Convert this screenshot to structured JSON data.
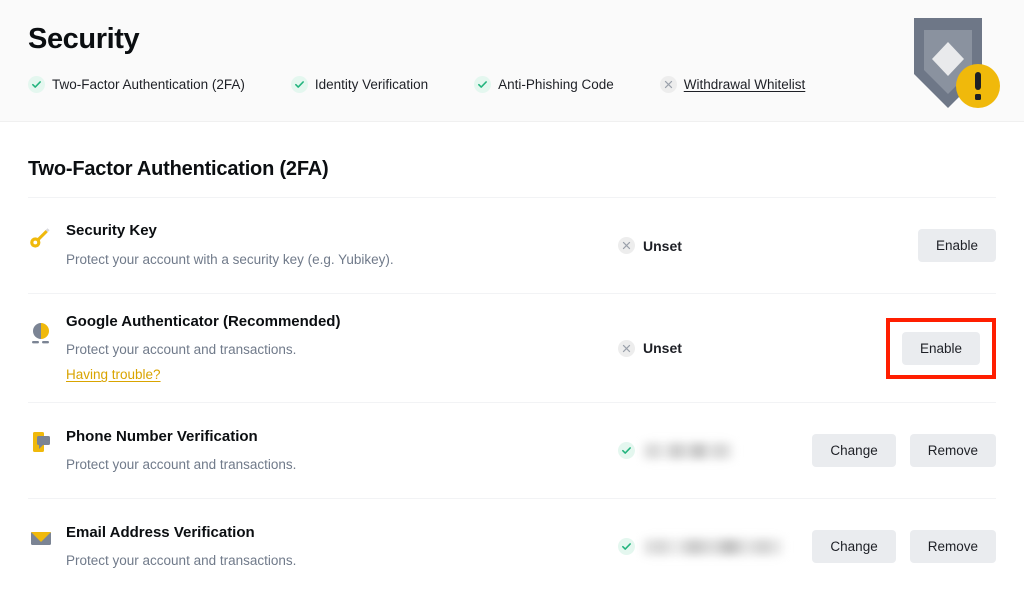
{
  "header": {
    "title": "Security",
    "shield_icon": "shield-warning-icon",
    "colors": {
      "shield_outer": "#6e7787",
      "shield_inner": "#8a929f",
      "shield_diamond": "#e9eaec",
      "warning_badge": "#f0b90b",
      "accent_link": "#d9a400",
      "check_green": "#23b47e",
      "highlight_red": "#ff1e00",
      "button_bg": "#eaecef",
      "header_bg": "#fafafa"
    },
    "status_items": [
      {
        "label": "Two-Factor Authentication (2FA)",
        "state": "ok",
        "icon": "check-circle-icon",
        "underlined": false
      },
      {
        "label": "Identity Verification",
        "state": "ok",
        "icon": "check-circle-icon",
        "underlined": false
      },
      {
        "label": "Anti-Phishing Code",
        "state": "ok",
        "icon": "check-circle-icon",
        "underlined": false
      },
      {
        "label": "Withdrawal Whitelist",
        "state": "none",
        "icon": "x-circle-icon",
        "underlined": true
      }
    ]
  },
  "main": {
    "section_title": "Two-Factor Authentication (2FA)",
    "rows": [
      {
        "name": "Security Key",
        "description": "Protect your account with a security key (e.g. Yubikey).",
        "icon": "security-key-icon",
        "link": null,
        "status_kind": "unset",
        "status_text": "Unset",
        "status_icon": "x-circle-icon",
        "actions": [
          {
            "label": "Enable",
            "name": "enable-button",
            "highlighted": false
          }
        ]
      },
      {
        "name": "Google Authenticator (Recommended)",
        "description": "Protect your account and transactions.",
        "icon": "google-authenticator-icon",
        "link": "Having trouble?",
        "status_kind": "unset",
        "status_text": "Unset",
        "status_icon": "x-circle-icon",
        "actions": [
          {
            "label": "Enable",
            "name": "enable-button",
            "highlighted": true
          }
        ]
      },
      {
        "name": "Phone Number Verification",
        "description": "Protect your account and transactions.",
        "icon": "phone-verification-icon",
        "link": null,
        "status_kind": "verified-redacted",
        "status_text": "",
        "status_icon": "check-circle-icon",
        "actions": [
          {
            "label": "Change",
            "name": "change-button",
            "highlighted": false
          },
          {
            "label": "Remove",
            "name": "remove-button",
            "highlighted": false
          }
        ]
      },
      {
        "name": "Email Address Verification",
        "description": "Protect your account and transactions.",
        "icon": "email-verification-icon",
        "link": null,
        "status_kind": "verified-redacted",
        "status_text": "",
        "status_icon": "check-circle-icon",
        "actions": [
          {
            "label": "Change",
            "name": "change-button",
            "highlighted": false
          },
          {
            "label": "Remove",
            "name": "remove-button",
            "highlighted": false
          }
        ]
      }
    ]
  }
}
